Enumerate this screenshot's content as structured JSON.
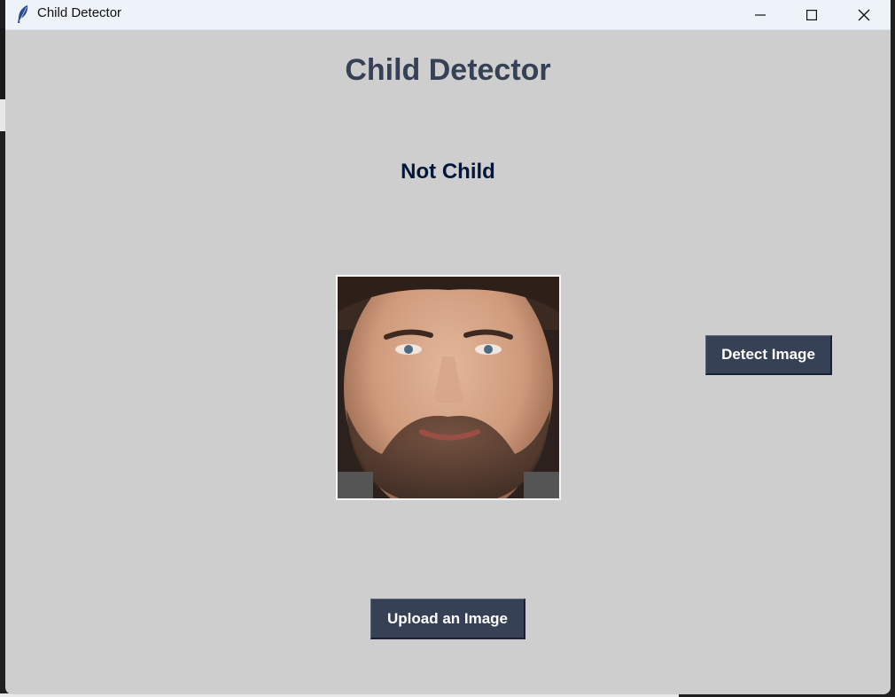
{
  "window": {
    "title": "Child Detector",
    "controls": [
      "minimize-icon",
      "maximize-icon",
      "close-icon"
    ]
  },
  "main": {
    "heading": "Child Detector",
    "result_label": "Not Child",
    "uploaded_image": "face-photo"
  },
  "buttons": {
    "detect_label": "Detect Image",
    "upload_label": "Upload an Image"
  },
  "colors": {
    "background": "#cecece",
    "heading": "#364156",
    "result": "#011638",
    "button_bg": "#364156",
    "button_text": "#ffffff",
    "titlebar": "#eef3fa"
  }
}
